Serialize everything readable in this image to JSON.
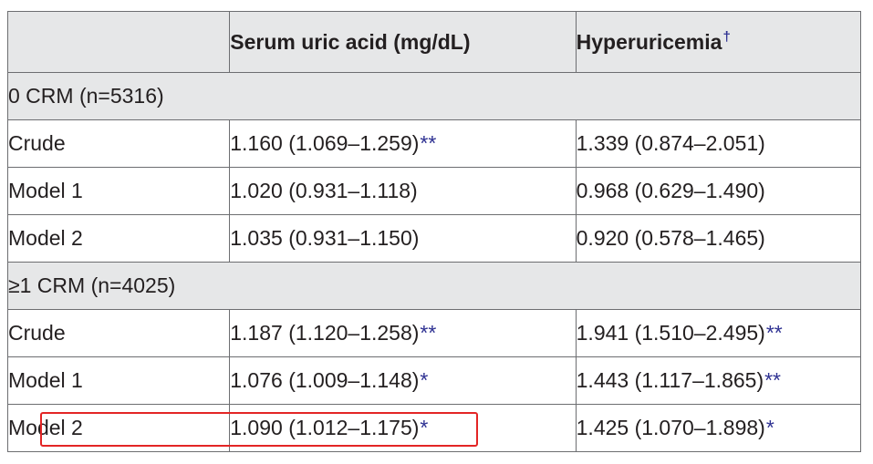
{
  "header": {
    "col1": "",
    "col2": "Serum uric acid (mg/dL)",
    "col3": "Hyperuricemia",
    "col3_mark": "†"
  },
  "groups": [
    {
      "label": "0 CRM (n=5316)",
      "rows": [
        {
          "model": "Crude",
          "sua": "1.160 (1.069–1.259)",
          "sua_sig": "**",
          "hyp": "1.339 (0.874–2.051)",
          "hyp_sig": ""
        },
        {
          "model": "Model 1",
          "sua": "1.020 (0.931–1.118)",
          "sua_sig": "",
          "hyp": "0.968 (0.629–1.490)",
          "hyp_sig": ""
        },
        {
          "model": "Model 2",
          "sua": "1.035 (0.931–1.150)",
          "sua_sig": "",
          "hyp": "0.920 (0.578–1.465)",
          "hyp_sig": ""
        }
      ]
    },
    {
      "label": "≥1 CRM (n=4025)",
      "rows": [
        {
          "model": "Crude",
          "sua": "1.187 (1.120–1.258)",
          "sua_sig": "**",
          "hyp": "1.941 (1.510–2.495)",
          "hyp_sig": "**"
        },
        {
          "model": "Model 1",
          "sua": "1.076 (1.009–1.148)",
          "sua_sig": "*",
          "hyp": "1.443 (1.117–1.865)",
          "hyp_sig": "**"
        },
        {
          "model": "Model 2",
          "sua": "1.090 (1.012–1.175)",
          "sua_sig": "*",
          "hyp": "1.425 (1.070–1.898)",
          "hyp_sig": "*"
        }
      ]
    }
  ],
  "colors": {
    "header_bg": "#e6e7e8",
    "significance_mark": "#2e3192",
    "highlight_box": "#e32525",
    "border": "#6d6e71"
  }
}
